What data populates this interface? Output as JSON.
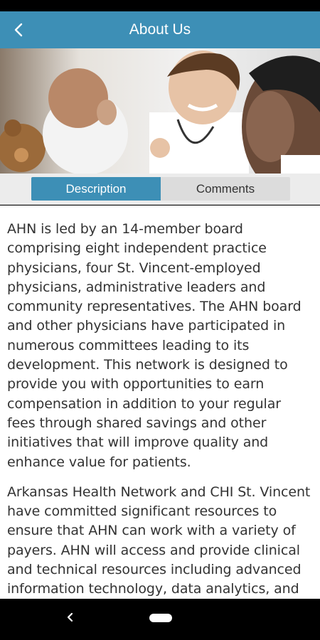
{
  "app_bar": {
    "title": "About Us",
    "back_icon": "chevron-left-icon",
    "background_color": "#3d8fb6"
  },
  "hero": {
    "description": "doctor-with-baby-photo"
  },
  "tabs": [
    {
      "label": "Description",
      "active": true
    },
    {
      "label": "Comments",
      "active": false
    }
  ],
  "content": {
    "paragraphs": [
      "AHN is led by an 14-member board comprising eight independent practice physicians, four St. Vincent-employed physicians, administrative leaders and community representatives. The AHN board and other physicians have participated in numerous committees leading to its development. This network is designed to provide you with opportunities to earn compensation in addition to your regular fees through shared savings and other initiatives that will improve quality and enhance value for patients.",
      "Arkansas Health Network and CHI St. Vincent have committed significant resources to ensure that AHN can work with a variety of payers. AHN will access and provide clinical and technical resources including advanced information technology, data analytics, and"
    ]
  },
  "system_nav": {
    "back_icon": "nav-back-icon",
    "home_icon": "nav-home-pill"
  }
}
